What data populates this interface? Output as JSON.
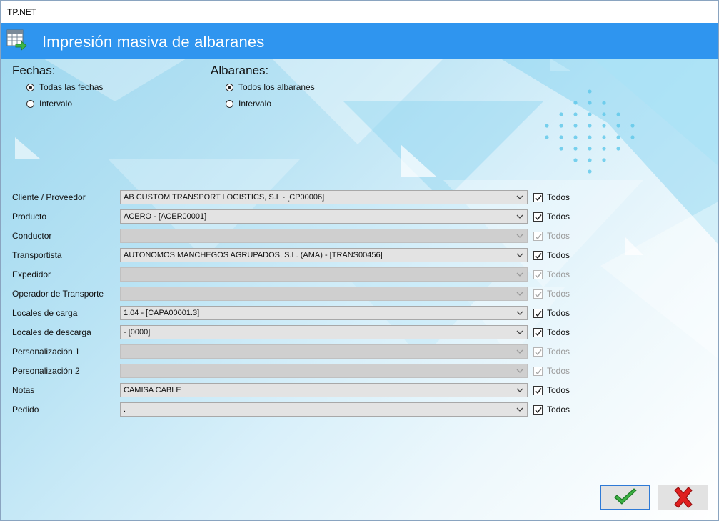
{
  "window": {
    "title": "TP.NET"
  },
  "header": {
    "title": "Impresión masiva de albaranes",
    "icon": "spreadsheet-arrow-icon"
  },
  "fechas": {
    "title": "Fechas:",
    "options": [
      {
        "label": "Todas las fechas",
        "selected": true
      },
      {
        "label": "Intervalo",
        "selected": false
      }
    ]
  },
  "albaranes": {
    "title": "Albaranes:",
    "options": [
      {
        "label": "Todos los albaranes",
        "selected": true
      },
      {
        "label": "Intervalo",
        "selected": false
      }
    ]
  },
  "filters": [
    {
      "label": "Cliente / Proveedor",
      "value": "AB CUSTOM TRANSPORT LOGISTICS, S.L - [CP00006]",
      "enabled": true,
      "todos_label": "Todos",
      "todos_checked": true
    },
    {
      "label": "Producto",
      "value": "ACERO - [ACER00001]",
      "enabled": true,
      "todos_label": "Todos",
      "todos_checked": true
    },
    {
      "label": "Conductor",
      "value": "",
      "enabled": false,
      "todos_label": "Todos",
      "todos_checked": true
    },
    {
      "label": "Transportista",
      "value": "AUTONOMOS MANCHEGOS AGRUPADOS, S.L. (AMA) - [TRANS00456]",
      "enabled": true,
      "todos_label": "Todos",
      "todos_checked": true
    },
    {
      "label": "Expedidor",
      "value": "",
      "enabled": false,
      "todos_label": "Todos",
      "todos_checked": true
    },
    {
      "label": "Operador de Transporte",
      "value": "",
      "enabled": false,
      "todos_label": "Todos",
      "todos_checked": true
    },
    {
      "label": "Locales de carga",
      "value": "1.04 - [CAPA00001.3]",
      "enabled": true,
      "todos_label": "Todos",
      "todos_checked": true
    },
    {
      "label": "Locales de descarga",
      "value": " - [0000]",
      "enabled": true,
      "todos_label": "Todos",
      "todos_checked": true
    },
    {
      "label": "Personalización 1",
      "value": "",
      "enabled": false,
      "todos_label": "Todos",
      "todos_checked": true
    },
    {
      "label": "Personalización 2",
      "value": "",
      "enabled": false,
      "todos_label": "Todos",
      "todos_checked": true
    },
    {
      "label": "Notas",
      "value": "CAMISA CABLE",
      "enabled": true,
      "todos_label": "Todos",
      "todos_checked": true
    },
    {
      "label": "Pedido",
      "value": ".",
      "enabled": true,
      "todos_label": "Todos",
      "todos_checked": true
    }
  ],
  "buttons": {
    "ok": {
      "icon": "green-check-icon",
      "color": "#3cb043"
    },
    "cancel": {
      "icon": "red-x-icon",
      "color": "#e02020"
    }
  }
}
